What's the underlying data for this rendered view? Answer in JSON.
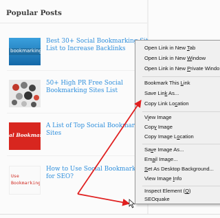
{
  "widget": {
    "title": "Popular Posts"
  },
  "posts": [
    {
      "title_line1": "Best 30+ Social Bookmarking Sit",
      "title_line2": "List to Increase Backlinks",
      "thumb_text": "bookmarking"
    },
    {
      "title_line1": "50+ High PR Free Social",
      "title_line2": "Bookmarking Sites List",
      "thumb_text": ""
    },
    {
      "title_line1": "A List of Top Social Bookmarkin",
      "title_line2": "Sites",
      "thumb_text": "al Bookmark"
    },
    {
      "title_line1": "How to Use Social Bookmarking",
      "title_line2": "for SEO?",
      "thumb_text_line1": "Use",
      "thumb_text_line2": "Bookmarking fo"
    }
  ],
  "context_menu": {
    "items": [
      {
        "label": "Open Link in New ",
        "accel": "T",
        "tail": "ab"
      },
      {
        "label": "Open Link in New ",
        "accel": "W",
        "tail": "indow"
      },
      {
        "label": "Open Link in New ",
        "accel": "P",
        "tail": "rivate Windo"
      },
      {
        "label": "Bookmark This ",
        "accel": "L",
        "tail": "ink"
      },
      {
        "label": "Save Lin",
        "accel": "k",
        "tail": " As..."
      },
      {
        "label": "Copy Link Lo",
        "accel": "c",
        "tail": "ation"
      },
      {
        "label": "V",
        "accel": "i",
        "tail": "ew Image"
      },
      {
        "label": "Cop",
        "accel": "y",
        "tail": " Image"
      },
      {
        "label": "Copy Image L",
        "accel": "o",
        "tail": "cation"
      },
      {
        "label": "Sa",
        "accel": "v",
        "tail": "e Image As..."
      },
      {
        "label": "Em",
        "accel": "a",
        "tail": "il Image..."
      },
      {
        "label": "",
        "accel": "S",
        "tail": "et As Desktop Background..."
      },
      {
        "label": "View Image ",
        "accel": "I",
        "tail": "nfo"
      },
      {
        "label": "Inspect Element (",
        "accel": "Q",
        "tail": ")"
      },
      {
        "label": "SEOquake",
        "accel": "",
        "tail": ""
      }
    ]
  },
  "colors": {
    "link": "#2f8fdc",
    "arrow": "#e02020",
    "menu_bg": "#f0f0f0"
  }
}
